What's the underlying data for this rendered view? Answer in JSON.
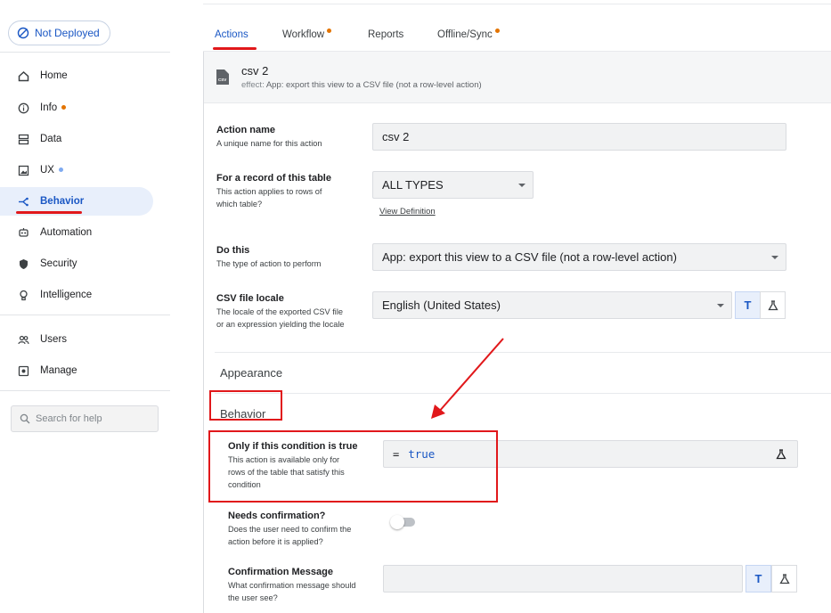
{
  "sidebar": {
    "deploy_status": "Not Deployed",
    "items": [
      {
        "label": "Home",
        "icon": "home-icon"
      },
      {
        "label": "Info",
        "icon": "info-icon",
        "dot": "#e37400"
      },
      {
        "label": "Data",
        "icon": "data-icon"
      },
      {
        "label": "UX",
        "icon": "ux-icon",
        "dot": "#7faaf0"
      },
      {
        "label": "Behavior",
        "icon": "behavior-icon",
        "active": true
      },
      {
        "label": "Automation",
        "icon": "automation-icon"
      },
      {
        "label": "Security",
        "icon": "shield-icon"
      },
      {
        "label": "Intelligence",
        "icon": "lightbulb-icon"
      },
      {
        "label": "Users",
        "icon": "users-icon"
      },
      {
        "label": "Manage",
        "icon": "manage-icon"
      }
    ],
    "search_placeholder": "Search for help"
  },
  "tabs": [
    {
      "label": "Actions",
      "active": true
    },
    {
      "label": "Workflow",
      "dot": "#e37400"
    },
    {
      "label": "Reports"
    },
    {
      "label": "Offline/Sync",
      "dot": "#e37400"
    }
  ],
  "action": {
    "title": "csv 2",
    "effect_label": "effect:",
    "effect_value": "App: export this view to a CSV file (not a row-level action)"
  },
  "fields": {
    "action_name": {
      "label": "Action name",
      "desc": "A unique name for this action",
      "value": "csv 2"
    },
    "record": {
      "label": "For a record of this table",
      "desc_1": "This action applies to rows of",
      "desc_2": "which table?",
      "value": "ALL TYPES",
      "link": "View Definition"
    },
    "do_this": {
      "label": "Do this",
      "desc": "The type of action to perform",
      "value": "App: export this view to a CSV file (not a row-level action)"
    },
    "locale": {
      "label": "CSV file locale",
      "desc_1": "The locale of the exported CSV file",
      "desc_2": "or an expression yielding the locale",
      "value": "English (United States)",
      "t_button": "T"
    },
    "appearance_section": "Appearance",
    "behavior_section": "Behavior",
    "condition": {
      "label": "Only if this condition is true",
      "desc_1": "This action is available only for",
      "desc_2": "rows of the table that satisfy this",
      "desc_3": "condition",
      "eq": "=",
      "value": "true"
    },
    "confirmation": {
      "label": "Needs confirmation?",
      "desc_1": "Does the user need to confirm the",
      "desc_2": "action before it is applied?",
      "enabled": false
    },
    "confirm_message": {
      "label": "Confirmation Message",
      "desc_1": "What confirmation message should",
      "desc_2": "the user see?",
      "value": "",
      "t_button": "T"
    }
  },
  "colors": {
    "accent": "#1a57c4",
    "annotation_red": "#e1181b",
    "active_bg": "#e8effb"
  }
}
